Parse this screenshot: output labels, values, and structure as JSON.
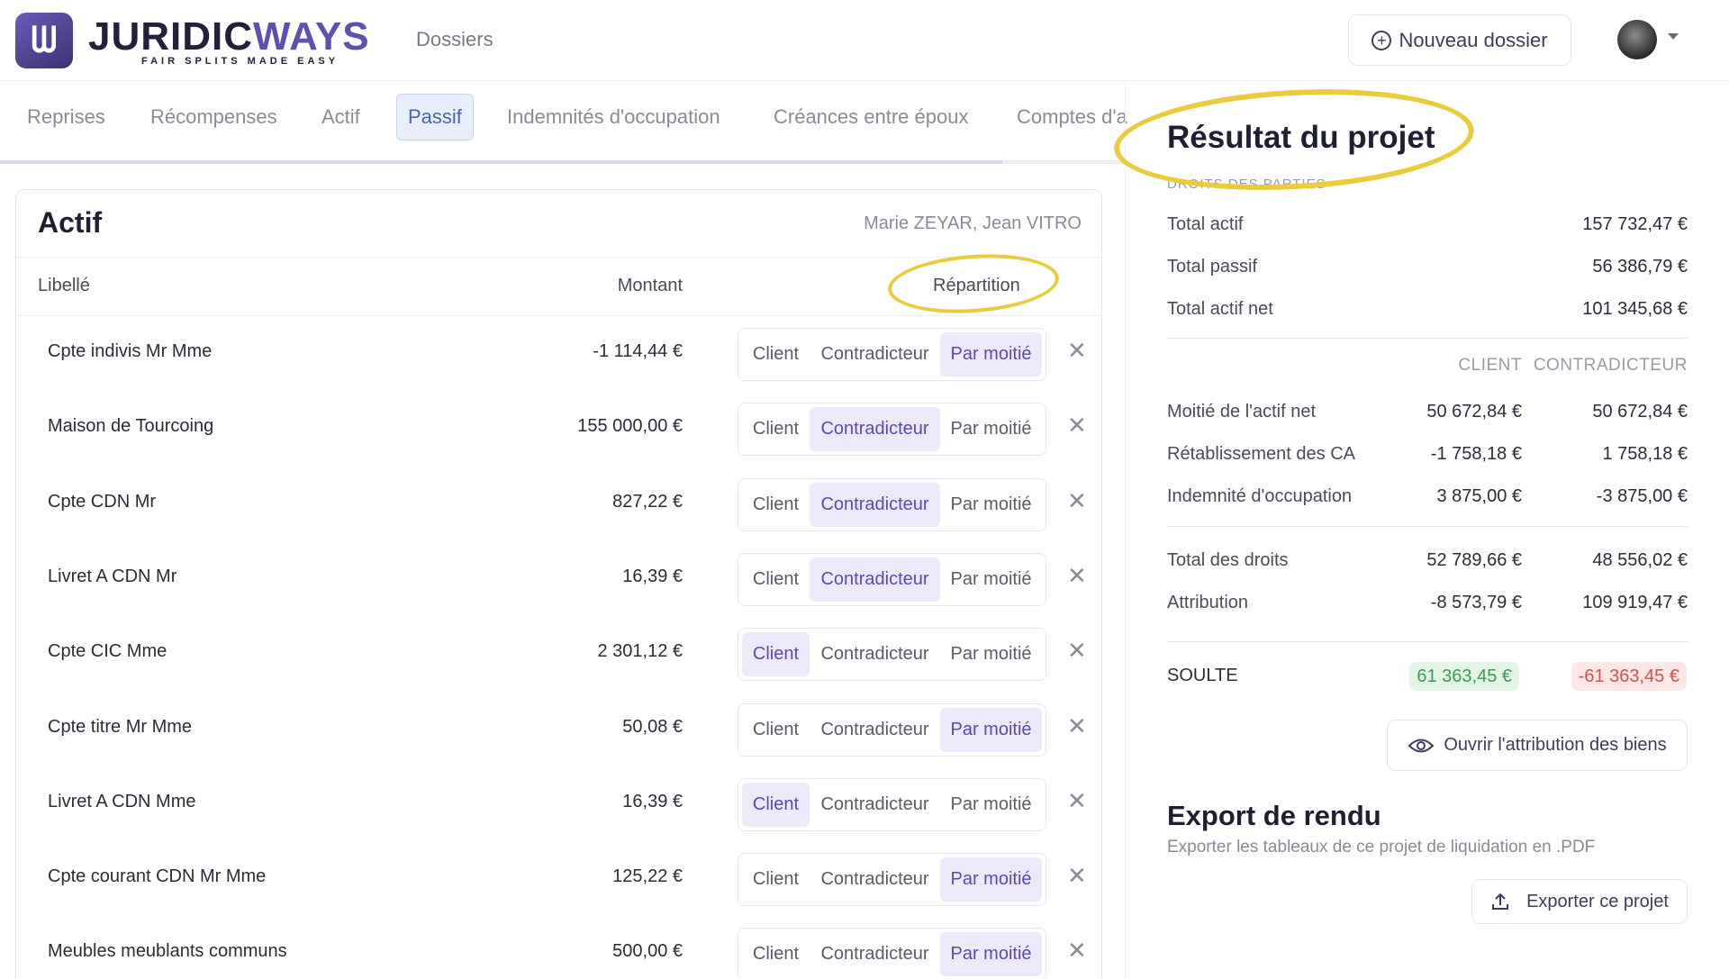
{
  "header": {
    "brand_main": "JURIDIC",
    "brand_accent": "WAYS",
    "brand_tagline": "FAIR SPLITS MADE EASY",
    "nav_dossiers": "Dossiers",
    "new_button": "Nouveau dossier"
  },
  "tabs": [
    {
      "label": "Reprises",
      "active": false
    },
    {
      "label": "Récompenses",
      "active": false
    },
    {
      "label": "Actif",
      "active": false
    },
    {
      "label": "Passif",
      "active": true
    },
    {
      "label": "Indemnités d'occupation",
      "active": false
    },
    {
      "label": "Créances entre époux",
      "active": false
    },
    {
      "label": "Comptes d'a",
      "active": false
    }
  ],
  "card": {
    "title": "Actif",
    "parties": "Marie ZEYAR, Jean VITRO",
    "col_libelle": "Libellé",
    "col_montant": "Montant",
    "col_repartition": "Répartition",
    "options": [
      "Client",
      "Contradicteur",
      "Par moitié"
    ],
    "rows": [
      {
        "label": "Cpte indivis Mr Mme",
        "amount": "-1 114,44 €",
        "selected": "Par moitié"
      },
      {
        "label": "Maison de Tourcoing",
        "amount": "155 000,00 €",
        "selected": "Contradicteur"
      },
      {
        "label": "Cpte CDN Mr",
        "amount": "827,22 €",
        "selected": "Contradicteur"
      },
      {
        "label": "Livret A CDN Mr",
        "amount": "16,39 €",
        "selected": "Contradicteur"
      },
      {
        "label": "Cpte CIC Mme",
        "amount": "2 301,12 €",
        "selected": "Client"
      },
      {
        "label": "Cpte titre Mr Mme",
        "amount": "50,08 €",
        "selected": "Par moitié"
      },
      {
        "label": "Livret A CDN Mme",
        "amount": "16,39 €",
        "selected": "Client"
      },
      {
        "label": "Cpte courant CDN Mr Mme",
        "amount": "125,22 €",
        "selected": "Par moitié"
      },
      {
        "label": "Meubles meublants communs",
        "amount": "500,00 €",
        "selected": "Par moitié"
      }
    ]
  },
  "result": {
    "title": "Résultat du projet",
    "subtitle": "DROITS DES PARTIES",
    "totals": [
      {
        "label": "Total actif",
        "value": "157 732,47 €"
      },
      {
        "label": "Total passif",
        "value": "56 386,79 €"
      },
      {
        "label": "Total actif net",
        "value": "101 345,68 €"
      }
    ],
    "col_client": "CLIENT",
    "col_contradicteur": "CONTRADICTEUR",
    "lines": [
      {
        "label": "Moitié de l'actif net",
        "client": "50 672,84 €",
        "contradicteur": "50 672,84 €"
      },
      {
        "label": "Rétablissement des CA",
        "client": "-1 758,18 €",
        "contradicteur": "1 758,18 €"
      },
      {
        "label": "Indemnité d'occupation",
        "client": "3 875,00 €",
        "contradicteur": "-3 875,00 €"
      }
    ],
    "lines2": [
      {
        "label": "Total des droits",
        "client": "52 789,66 €",
        "contradicteur": "48 556,02 €"
      },
      {
        "label": "Attribution",
        "client": "-8 573,79 €",
        "contradicteur": "109 919,47 €"
      }
    ],
    "soulte_label": "SOULTE",
    "soulte_client": "61 363,45 €",
    "soulte_contradicteur": "-61 363,45 €",
    "open_button": "Ouvrir l'attribution des biens",
    "export_title": "Export de rendu",
    "export_subtitle": "Exporter les tableaux de ce projet de liquidation en .PDF",
    "export_button": "Exporter ce projet"
  },
  "colors": {
    "brand": "#5f4fb0",
    "selected_bg": "#ede9fb",
    "positive": "#3f9a55",
    "negative": "#d65050",
    "marker": "#e8cc3c"
  }
}
